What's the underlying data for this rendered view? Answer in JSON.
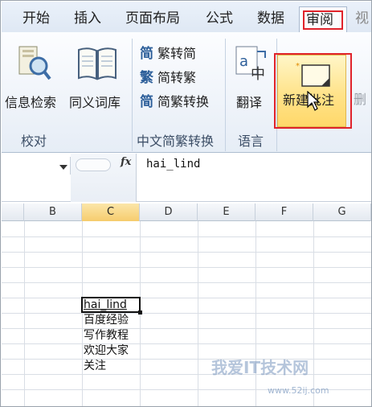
{
  "tabs": [
    {
      "label": "开始"
    },
    {
      "label": "插入"
    },
    {
      "label": "页面布局"
    },
    {
      "label": "公式"
    },
    {
      "label": "数据"
    },
    {
      "label": "审阅",
      "active": true
    },
    {
      "label": "视"
    }
  ],
  "ribbon": {
    "proofing": {
      "label": "校对",
      "research_label": "信息检索",
      "thesaurus_label": "同义词库"
    },
    "chinese_conversion": {
      "label": "中文简繁转换",
      "to_simplified": "繁转简",
      "to_traditional": "简转繁",
      "convert": "简繁转换",
      "icon_simplified": "简",
      "icon_traditional": "繁",
      "icon_convert": "简"
    },
    "language": {
      "label": "语言",
      "translate_label": "翻译"
    },
    "comments": {
      "new_comment_label": "新建批注",
      "next_label": "删"
    }
  },
  "formula_bar": {
    "fx_label": "fx",
    "value": "hai_lind"
  },
  "grid": {
    "columns": [
      "B",
      "C",
      "D",
      "E",
      "F",
      "G"
    ],
    "selected_column": "C",
    "cells": [
      "hai_lind",
      "百度经验",
      "写作教程",
      "欢迎大家",
      "关注"
    ]
  },
  "watermark": {
    "text": "我爱IT技术网",
    "url": "www.52ij.com"
  },
  "colors": {
    "highlight_red": "#e0232b",
    "button_hover": "#ffe38a",
    "ribbon_bg": "#e6edf6"
  }
}
